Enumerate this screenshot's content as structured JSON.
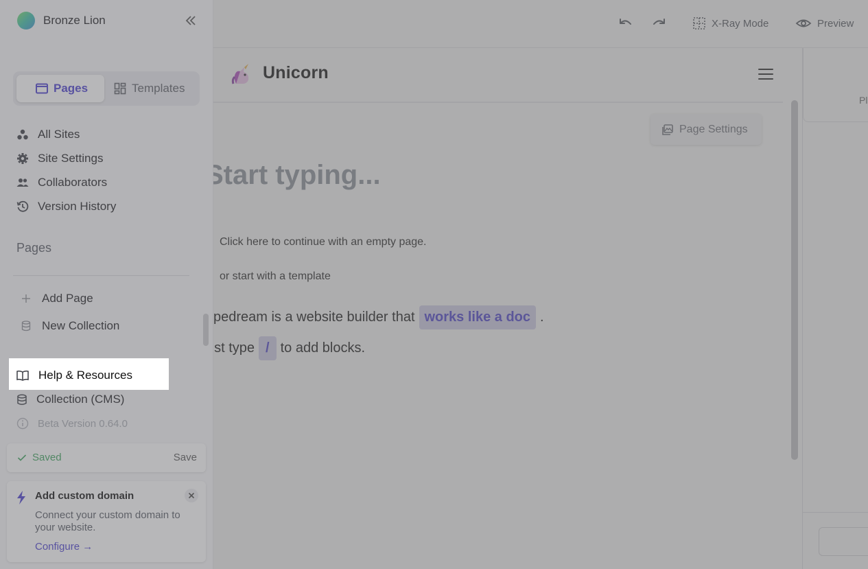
{
  "sidebar": {
    "workspace_name": "Bronze Lion",
    "segmented": {
      "pages_label": "Pages",
      "templates_label": "Templates"
    },
    "nav": [
      {
        "label": "All Sites"
      },
      {
        "label": "Site Settings"
      },
      {
        "label": "Collaborators"
      },
      {
        "label": "Version History"
      }
    ],
    "pages_heading": "Pages",
    "add_page": "Add Page",
    "new_collection": "New Collection",
    "help": "Help & Resources",
    "cms": "Collection (CMS)",
    "beta": "Beta Version 0.64.0",
    "saved_label": "Saved",
    "save_button": "Save",
    "domain_card": {
      "title": "Add custom domain",
      "description": "Connect your custom domain to your website.",
      "configure": "Configure →"
    }
  },
  "toolbar": {
    "xray_label": "X-Ray Mode",
    "preview_label": "Preview"
  },
  "canvas": {
    "site_name": "Unicorn",
    "page_settings": "Page Settings",
    "heading_placeholder": "Start typing...",
    "empty_page": "Click here to continue with an empty page.",
    "template_link": "or start with a template",
    "para1_before": "ypedream is a website builder that",
    "para1_highlight": "works like a doc",
    "para1_after": ".",
    "para2_before": "ust type",
    "para2_key": "/",
    "para2_after": "to add blocks."
  },
  "right_panel": {
    "card_text": "Pl"
  },
  "colors": {
    "accent": "#4a3fd0",
    "saved": "#3da35d",
    "overlay": "#69696c"
  }
}
